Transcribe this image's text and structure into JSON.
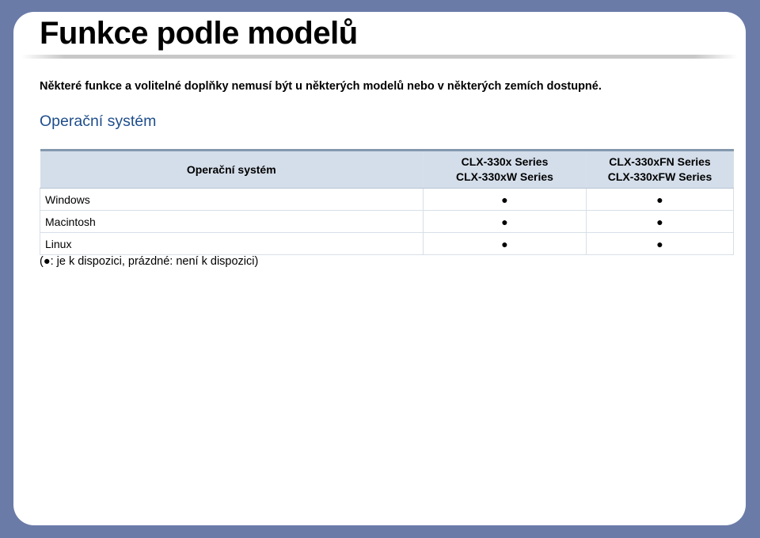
{
  "title": "Funkce podle modelů",
  "note": "Některé funkce a volitelné doplňky nemusí být u některých modelů nebo v některých zemích dostupné.",
  "section_heading": "Operační systém",
  "table": {
    "header": {
      "os": "Operační systém",
      "model_a": [
        "CLX-330x Series",
        "CLX-330xW Series"
      ],
      "model_b": [
        "CLX-330xFN Series",
        "CLX-330xFW Series"
      ]
    },
    "rows": [
      {
        "os": "Windows",
        "a": "●",
        "b": "●"
      },
      {
        "os": "Macintosh",
        "a": "●",
        "b": "●"
      },
      {
        "os": "Linux",
        "a": "●",
        "b": "●"
      }
    ]
  },
  "legend": "(●: je k dispozici, prázdné: není k dispozici)",
  "colors": {
    "background": "#6b7ba8",
    "page": "#ffffff",
    "heading_accent": "#1f4e8c",
    "table_header": "#d4deea"
  }
}
